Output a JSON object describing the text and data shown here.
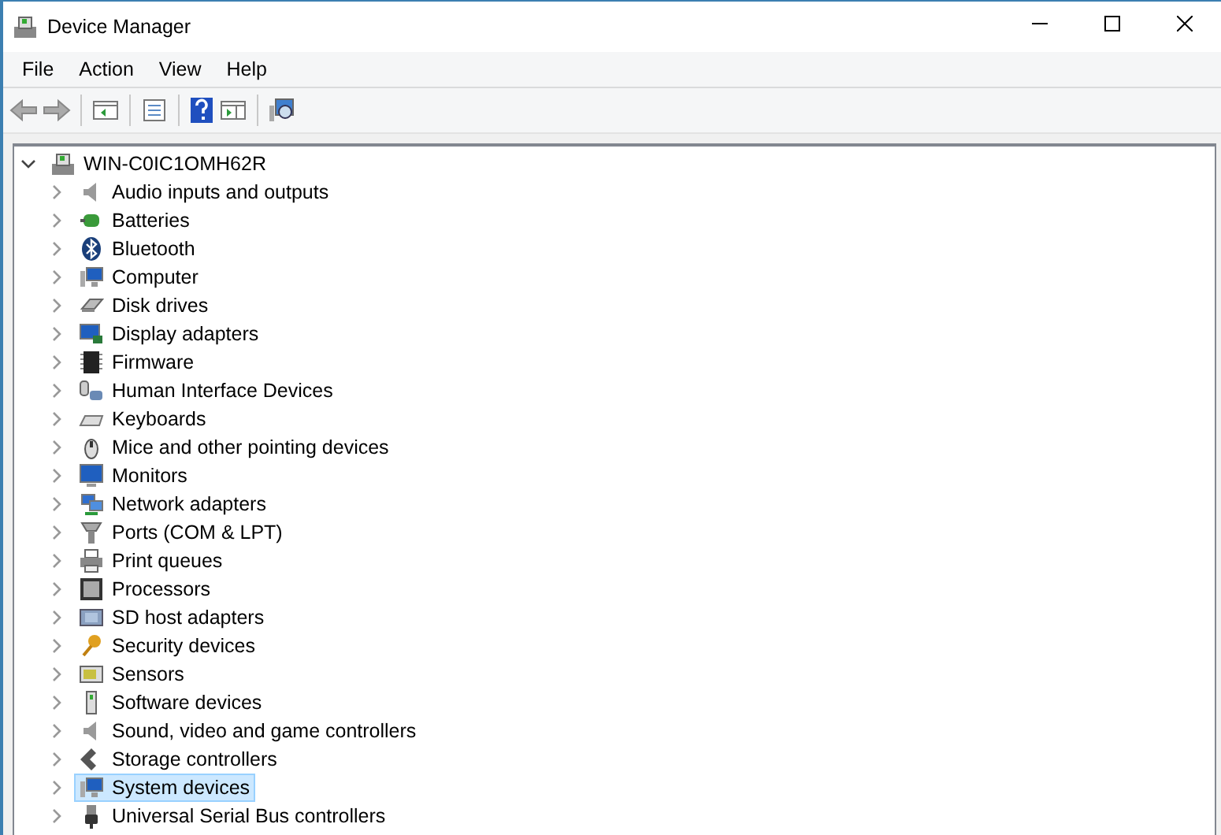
{
  "window": {
    "title": "Device Manager"
  },
  "menu": [
    "File",
    "Action",
    "View",
    "Help"
  ],
  "tree": {
    "label": "WIN-C0IC1OMH62R",
    "expanded": true,
    "selected": false,
    "children": [
      {
        "label": "Audio inputs and outputs",
        "expanded": false,
        "selected": false
      },
      {
        "label": "Batteries",
        "expanded": false,
        "selected": false
      },
      {
        "label": "Bluetooth",
        "expanded": false,
        "selected": false
      },
      {
        "label": "Computer",
        "expanded": false,
        "selected": false
      },
      {
        "label": "Disk drives",
        "expanded": false,
        "selected": false
      },
      {
        "label": "Display adapters",
        "expanded": false,
        "selected": false
      },
      {
        "label": "Firmware",
        "expanded": false,
        "selected": false
      },
      {
        "label": "Human Interface Devices",
        "expanded": false,
        "selected": false
      },
      {
        "label": "Keyboards",
        "expanded": false,
        "selected": false
      },
      {
        "label": "Mice and other pointing devices",
        "expanded": false,
        "selected": false
      },
      {
        "label": "Monitors",
        "expanded": false,
        "selected": false
      },
      {
        "label": "Network adapters",
        "expanded": false,
        "selected": false
      },
      {
        "label": "Ports (COM & LPT)",
        "expanded": false,
        "selected": false
      },
      {
        "label": "Print queues",
        "expanded": false,
        "selected": false
      },
      {
        "label": "Processors",
        "expanded": false,
        "selected": false
      },
      {
        "label": "SD host adapters",
        "expanded": false,
        "selected": false
      },
      {
        "label": "Security devices",
        "expanded": false,
        "selected": false
      },
      {
        "label": "Sensors",
        "expanded": false,
        "selected": false
      },
      {
        "label": "Software devices",
        "expanded": false,
        "selected": false
      },
      {
        "label": "Sound, video and game controllers",
        "expanded": false,
        "selected": false
      },
      {
        "label": "Storage controllers",
        "expanded": false,
        "selected": false
      },
      {
        "label": "System devices",
        "expanded": false,
        "selected": true
      },
      {
        "label": "Universal Serial Bus controllers",
        "expanded": false,
        "selected": false
      }
    ]
  }
}
